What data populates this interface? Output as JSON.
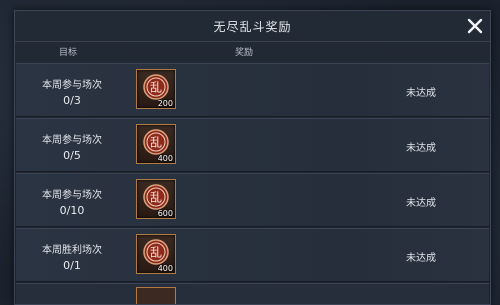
{
  "dialog": {
    "title": "无尽乱斗奖励",
    "close_icon": "close-x-icon"
  },
  "columns": {
    "goal": "目标",
    "reward": "奖励"
  },
  "rows": [
    {
      "label": "本周参与场次",
      "progress": "0/3",
      "reward_icon": "luan-token-icon",
      "reward_glyph": "乱",
      "reward_amount": "200",
      "status": "未达成"
    },
    {
      "label": "本周参与场次",
      "progress": "0/5",
      "reward_icon": "luan-token-icon",
      "reward_glyph": "乱",
      "reward_amount": "400",
      "status": "未达成"
    },
    {
      "label": "本周参与场次",
      "progress": "0/10",
      "reward_icon": "luan-token-icon",
      "reward_glyph": "乱",
      "reward_amount": "600",
      "status": "未达成"
    },
    {
      "label": "本周胜利场次",
      "progress": "0/1",
      "reward_icon": "luan-token-icon",
      "reward_glyph": "乱",
      "reward_amount": "400",
      "status": "未达成"
    }
  ],
  "colors": {
    "panel_bg": "#222a36",
    "row_bg": "#2b3442",
    "icon_border": "#b07a44",
    "token_red": "#8e2a1c"
  }
}
